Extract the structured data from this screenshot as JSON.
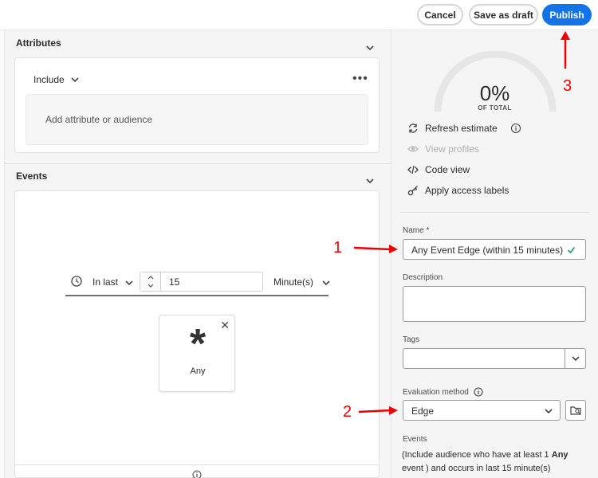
{
  "toolbar": {
    "cancel_label": "Cancel",
    "save_draft_label": "Save as draft",
    "publish_label": "Publish"
  },
  "attributes": {
    "title": "Attributes",
    "include_label": "Include",
    "add_placeholder": "Add attribute or audience"
  },
  "events": {
    "title": "Events",
    "time_operator": "In last",
    "time_value": "15",
    "time_unit": "Minute(s)",
    "card_symbol": "*",
    "card_label": "Any"
  },
  "estimate": {
    "percent": "0%",
    "caption": "OF TOTAL"
  },
  "actions": [
    {
      "label": "Refresh estimate",
      "icon": "refresh-icon",
      "enabled": true
    },
    {
      "label": "View profiles",
      "icon": "eye-icon",
      "enabled": false
    },
    {
      "label": "Code view",
      "icon": "code-icon",
      "enabled": true
    },
    {
      "label": "Apply access labels",
      "icon": "key-icon",
      "enabled": true
    }
  ],
  "form": {
    "name_label": "Name",
    "name_required": "*",
    "name_value": "Any Event Edge (within 15 minutes)",
    "description_label": "Description",
    "tags_label": "Tags",
    "evaluation_label": "Evaluation method",
    "evaluation_value": "Edge",
    "events_label": "Events",
    "events_summary_prefix": "(Include audience who have at least 1 ",
    "events_summary_bold": "Any",
    "events_summary_suffix": " event ) and occurs in last 15 minute(s)"
  },
  "annotations": {
    "one": "1",
    "two": "2",
    "three": "3"
  },
  "colors": {
    "accent": "#1473e6",
    "annotation": "#e00000",
    "valid_check": "#2d9d78"
  }
}
